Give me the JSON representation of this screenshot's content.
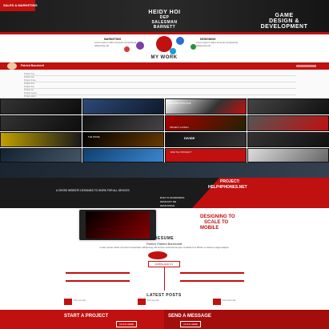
{
  "hero": {
    "left_title": "SALES & MARKETING",
    "center_title": "HEIDY HOI",
    "center_sub1": "DEP",
    "center_sub2": "SALESMAN",
    "center_sub3": "BARNETT",
    "right_title_1": "GAME",
    "right_title_2": "DESIGN &",
    "right_title_3": "DEVELOPMENT"
  },
  "skills": {
    "left_head": "MARKETING",
    "right_head": "DESIGNING",
    "left_text": "Lorem ipsum dolor sit amet consectetur adipiscing elit",
    "right_text": "Lorem ipsum dolor sit amet consectetur adipiscing elit"
  },
  "portfolio": {
    "title": "MY WORK",
    "nav_label": "Patrick Boucherti",
    "list": [
      "Project one",
      "Project two",
      "Project three",
      "Project four",
      "Project five",
      "Project six",
      "Project seven",
      "Project eight"
    ],
    "tile_labels": [
      "DESIGNED WITH LOVE",
      "THE DIVIDE",
      "PROJECT LAUNCH",
      "DIVIDE",
      "DIGITAL PROJECT"
    ]
  },
  "project": {
    "title1": "PROJECT:",
    "title2": "HELP4PHONES.NET",
    "left_text": "A CROSS WEBSITE DESIGNED TO WORK FOR ALL DEVICES",
    "bullet1": "BUILT IN WORDPRESS",
    "bullet2": "DESIGN BY ME",
    "bullet3": "RESPONSIVE",
    "design_title1": "DESIGNING TO",
    "design_title2": "SCALE TO",
    "design_title3": "MOBILE"
  },
  "resume": {
    "title": "RESUME",
    "name": "Patrick Patient Barnhardt",
    "intro": "Lorem ipsum dolor sit amet consectetur adipiscing elit sed do eiusmod tempor incididunt ut labore et dolore magna aliqua",
    "button": "DOWNLOAD CV"
  },
  "latest": {
    "title": "LATEST POSTS",
    "posts": [
      "Post one title",
      "Post two title",
      "Post three title"
    ]
  },
  "footer": {
    "start": "START A PROJECT",
    "send": "SEND A MESSAGE",
    "start_btn": "CLICK HERE",
    "send_btn": "CLICK HERE"
  },
  "colors": {
    "accent": "#c0100f",
    "dark": "#1b1b1b"
  }
}
